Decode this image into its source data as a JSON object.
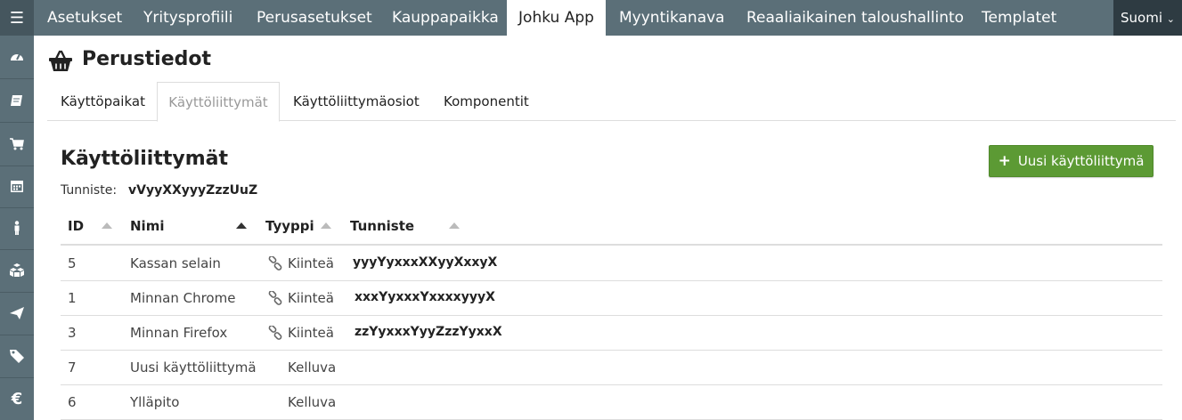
{
  "topnav": {
    "menu_icon": "hamburger-icon",
    "tabs": [
      {
        "label": "Asetukset"
      },
      {
        "label": "Yritysprofiili"
      },
      {
        "label": "Perusasetukset"
      },
      {
        "label": "Kauppapaikka"
      },
      {
        "label": "Johku App",
        "active": true
      },
      {
        "label": "Myyntikanava"
      },
      {
        "label": "Reaaliaikainen taloushallinto"
      },
      {
        "label": "Templatet"
      }
    ],
    "language": "Suomi"
  },
  "sidebar": {
    "items": [
      {
        "icon": "dashboard-icon"
      },
      {
        "icon": "book-icon"
      },
      {
        "icon": "cart-icon"
      },
      {
        "icon": "calendar-icon"
      },
      {
        "icon": "person-icon"
      },
      {
        "icon": "cubes-icon"
      },
      {
        "icon": "send-icon"
      },
      {
        "icon": "tag-icon"
      },
      {
        "icon": "euro-icon"
      }
    ]
  },
  "page": {
    "icon": "basket-icon",
    "title": "Perustiedot"
  },
  "subtabs": [
    {
      "label": "Käyttöpaikat"
    },
    {
      "label": "Käyttöliittymät",
      "active": true
    },
    {
      "label": "Käyttöliittymäosiot"
    },
    {
      "label": "Komponentit"
    }
  ],
  "section": {
    "title": "Käyttöliittymät",
    "identifier_label": "Tunniste:",
    "identifier_value": "vVyyXXyyyZzzUuZ",
    "new_button_label": "Uusi käyttöliittymä",
    "accent_color": "#5c9a34"
  },
  "table": {
    "columns": [
      "ID",
      "Nimi",
      "Tyyppi",
      "Tunniste"
    ],
    "sorted_column": "Nimi",
    "rows": [
      {
        "id": "5",
        "name": "Kassan selain",
        "type": "Kiinteä",
        "linked": true,
        "identifier": "yyyYyxxxXXyyXxxyX"
      },
      {
        "id": "1",
        "name": "Minnan Chrome",
        "type": "Kiinteä",
        "linked": true,
        "identifier": "xxxYyxxxYxxxxyyyX"
      },
      {
        "id": "3",
        "name": "Minnan Firefox",
        "type": "Kiinteä",
        "linked": true,
        "identifier": "zzYyxxxYyyZzzYyxxX"
      },
      {
        "id": "7",
        "name": "Uusi käyttöliittymä",
        "type": "Kelluva",
        "linked": false,
        "identifier": ""
      },
      {
        "id": "6",
        "name": "Ylläpito",
        "type": "Kelluva",
        "linked": false,
        "identifier": ""
      }
    ]
  }
}
